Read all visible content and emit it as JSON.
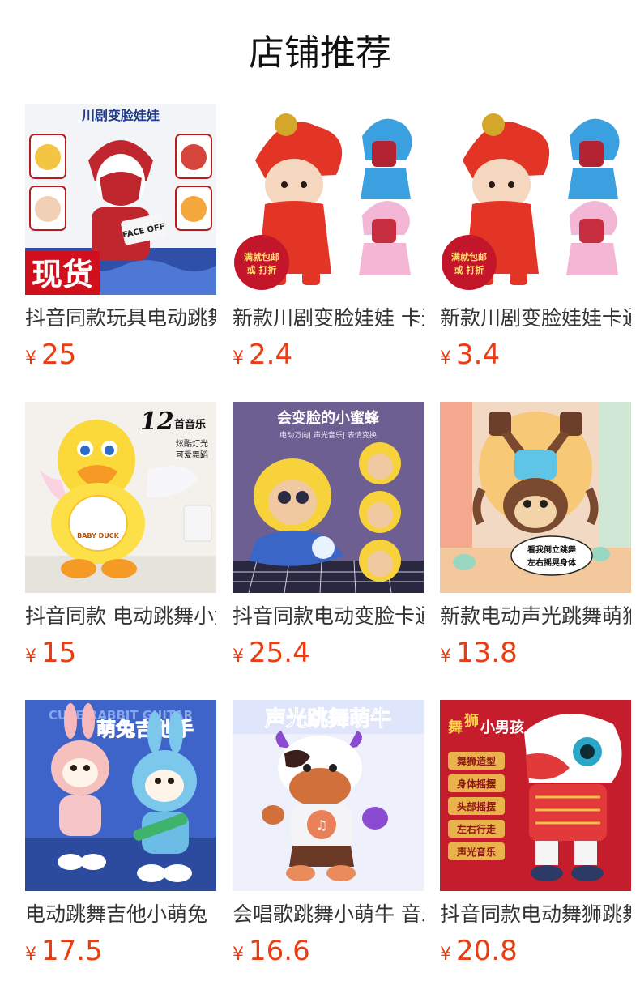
{
  "section": {
    "title": "店铺推荐"
  },
  "colors": {
    "price": "#ea3d12",
    "title_text": "#333333"
  },
  "products": [
    {
      "title": "抖音同款玩具电动跳舞川剧变脸娃娃",
      "currency": "¥",
      "price": "25",
      "image_overlay": {
        "top": "川剧变脸娃娃",
        "badge": "现货",
        "mask": "FACE OFF"
      },
      "image_icon": "opera-face-doll-image"
    },
    {
      "title": "新款川剧变脸娃娃 卡通电动",
      "currency": "¥",
      "price": "2.4",
      "image_overlay": {
        "badge_line1": "满就包邮",
        "badge_line2": "或 打折"
      },
      "image_icon": "cartoon-opera-dolls-image"
    },
    {
      "title": "新款川剧变脸娃娃卡通电动",
      "currency": "¥",
      "price": "3.4",
      "image_overlay": {
        "badge_line1": "满就包邮",
        "badge_line2": "或 打折"
      },
      "image_icon": "cartoon-opera-dolls-image"
    },
    {
      "title": "抖音同款 电动跳舞小黄鸭",
      "currency": "¥",
      "price": "15",
      "image_overlay": {
        "num": "12",
        "line1": "首音乐",
        "line2": "炫酷灯光",
        "line3": "可爱舞蹈",
        "tag": "BABY DUCK"
      },
      "image_icon": "dancing-duck-image"
    },
    {
      "title": "抖音同款电动变脸卡通小蜜蜂",
      "currency": "¥",
      "price": "25.4",
      "image_overlay": {
        "top": "会变脸的小蜜蜂",
        "sub": "电动万向| 声光音乐| 表情变换"
      },
      "image_icon": "face-changing-bee-image"
    },
    {
      "title": "新款电动声光跳舞萌猴",
      "currency": "¥",
      "price": "13.8",
      "image_overlay": {
        "bubble1": "看我倒立跳舞",
        "bubble2": "左右摇晃身体"
      },
      "image_icon": "handstand-monkey-image"
    },
    {
      "title": "电动跳舞吉他小萌兔",
      "currency": "¥",
      "price": "17.5",
      "image_overlay": {
        "top": "萌兔吉他手",
        "bg": "CUTE RABBIT GUITAR"
      },
      "image_icon": "guitar-rabbit-image"
    },
    {
      "title": "会唱歌跳舞小萌牛 音乐玩具",
      "currency": "¥",
      "price": "16.6",
      "image_overlay": {
        "top": "声光跳舞萌牛"
      },
      "image_icon": "dancing-cow-image"
    },
    {
      "title": "抖音同款电动舞狮跳舞男孩",
      "currency": "¥",
      "price": "20.8",
      "image_overlay": {
        "top_a": "舞",
        "top_b": "狮",
        "top_c": "小男孩",
        "f1": "舞狮造型",
        "f2": "身体摇摆",
        "f3": "头部摇摆",
        "f4": "左右行走",
        "f5": "声光音乐"
      },
      "image_icon": "lion-dance-boy-image"
    }
  ]
}
